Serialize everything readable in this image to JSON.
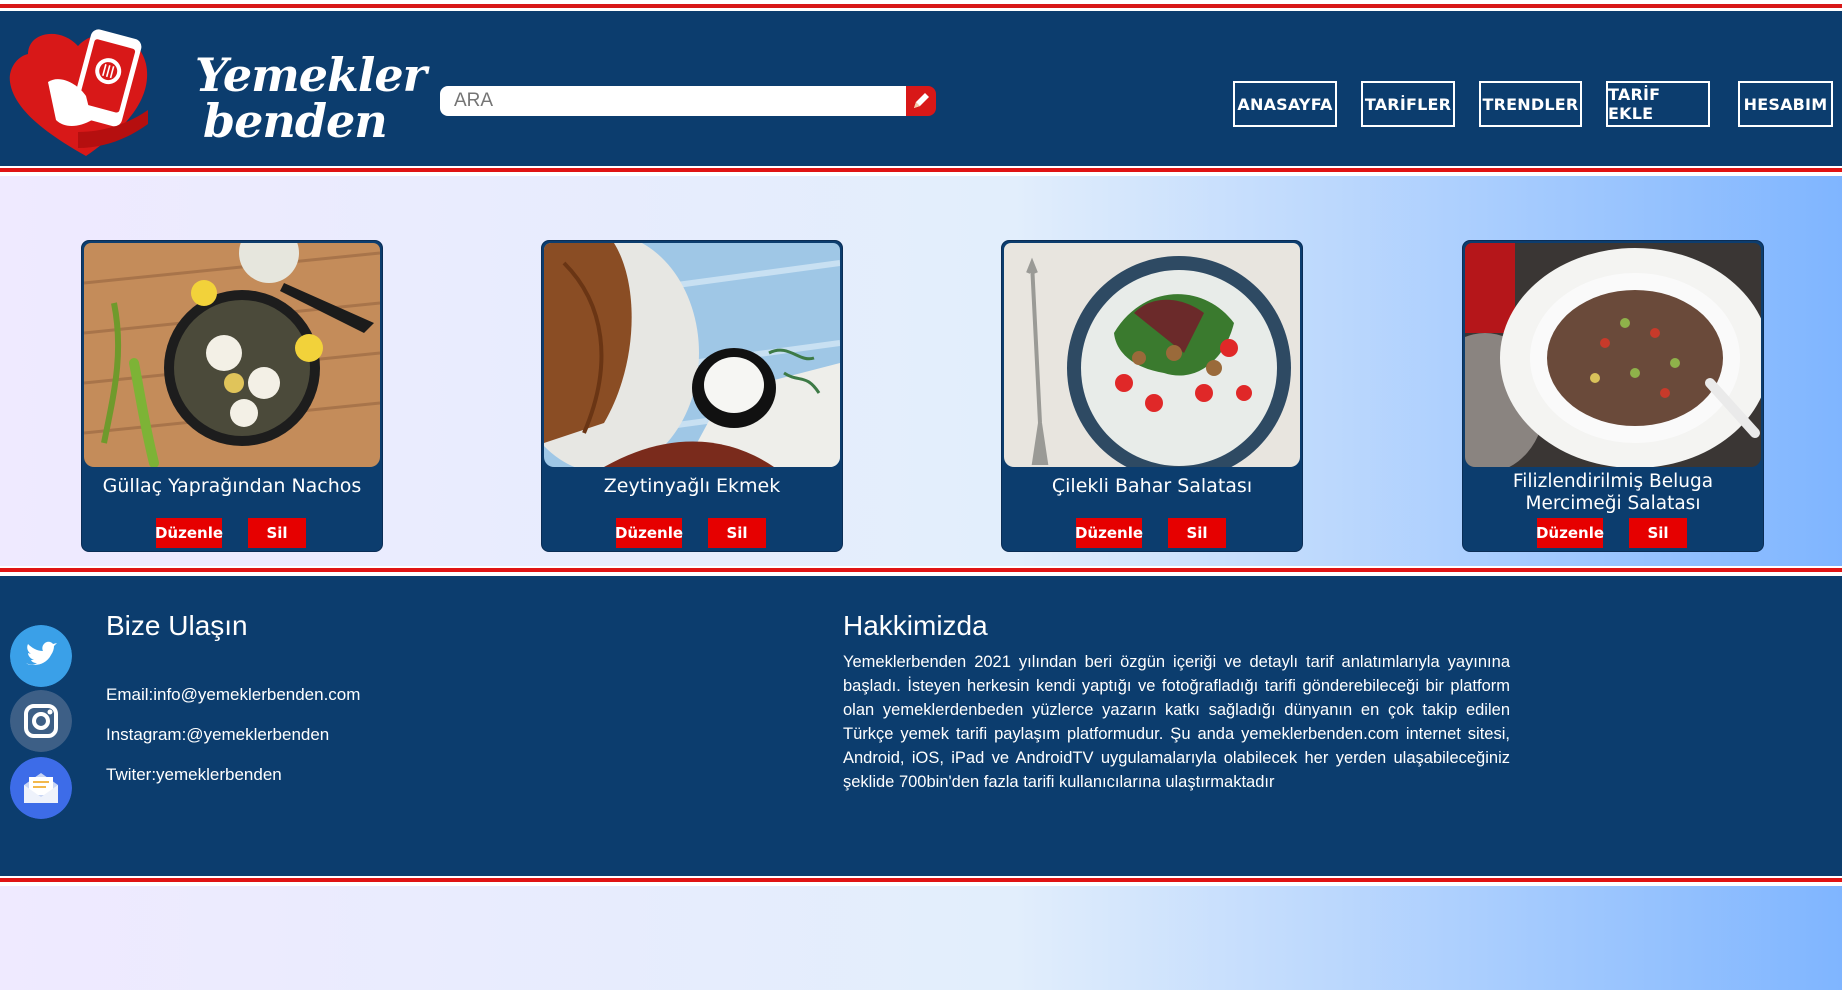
{
  "brand": {
    "line1": "Yemekler",
    "line2": "benden"
  },
  "search": {
    "placeholder": "ARA"
  },
  "nav": [
    "ANASAYFA",
    "TARİFLER",
    "TRENDLER",
    "TARİF EKLE",
    "HESABIM"
  ],
  "cards": [
    {
      "title": "Güllaç Yaprağından Nachos",
      "edit": "Düzenle",
      "delete": "Sil"
    },
    {
      "title": "Zeytinyağlı Ekmek",
      "edit": "Düzenle",
      "delete": "Sil"
    },
    {
      "title": "Çilekli Bahar Salatası",
      "edit": "Düzenle",
      "delete": "Sil"
    },
    {
      "title": "Filizlendirilmiş Beluga Mercimeği Salatası",
      "edit": "Düzenle",
      "delete": "Sil"
    }
  ],
  "contact": {
    "heading": "Bize Ulaşın",
    "email": "Email:info@yemeklerbenden.com",
    "instagram": "Instagram:@yemeklerbenden",
    "twitter": "Twiter:yemeklerbenden"
  },
  "about": {
    "heading": "Hakkimizda",
    "text": "Yemeklerbenden 2021 yılından beri özgün içeriği ve detaylı tarif anlatımlarıyla yayınına başladı. İsteyen herkesin kendi yaptığı ve fotoğrafladığı tarifi gönderebileceği bir platform olan yemeklerdenbeden yüzlerce yazarın katkı sağladığı dünyanın en çok takip edilen Türkçe yemek tarifi paylaşım platformudur. Şu anda yemeklerbenden.com internet sitesi, Android, iOS, iPad ve AndroidTV uygulamalarıyla olabilecek her yerden ulaşabileceğiniz şeklide 700bin'den fazla tarifi kullanıcılarına ulaştırmaktadır"
  },
  "colors": {
    "navy": "#0c3d6e",
    "red": "#e60000",
    "accent_stripe": "#e01414"
  },
  "icons": {
    "social": [
      "twitter-icon",
      "instagram-icon",
      "mail-icon"
    ],
    "search": "pencil-icon"
  }
}
